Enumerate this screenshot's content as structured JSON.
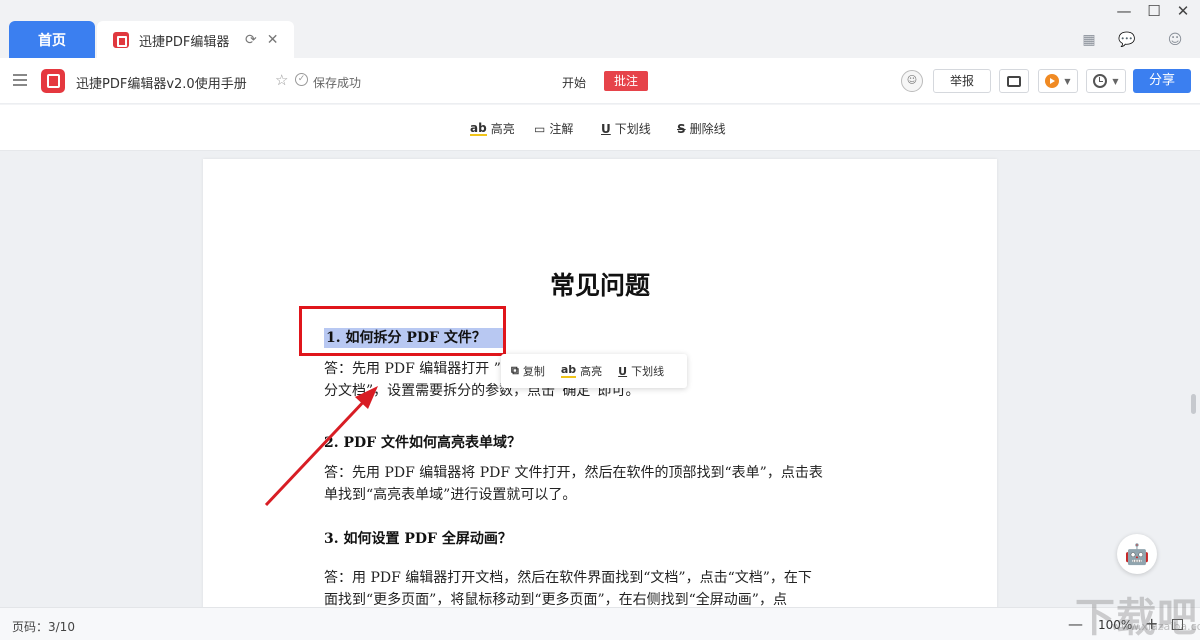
{
  "tabs": {
    "home": "首页",
    "doc": "迅捷PDF编辑器"
  },
  "toolbar": {
    "doc_title": "迅捷PDF编辑器v2.0使用手册",
    "save_status": "保存成功",
    "mode_start": "开始",
    "mode_annotate": "批注",
    "report": "举报",
    "share": "分享"
  },
  "annot_toolbar": {
    "highlight_icon": "ab",
    "highlight": "高亮",
    "note": "注解",
    "underline": "下划线",
    "strikethrough": "删除线"
  },
  "selection_popup": {
    "copy": "复制",
    "highlight_icon": "ab",
    "highlight": "高亮",
    "underline": "下划线"
  },
  "document": {
    "title": "常见问题",
    "q1": "1.  如何拆分 PDF 文件？",
    "a1_line1": "答：先用 PDF 编辑器打开                               ”，点击“文档”，找到“拆",
    "a1_line2": "分文档”，设置需要拆分的参数，点击“确定”即可。",
    "q2": "2.  PDF 文件如何高亮表单域？",
    "a2_line1": "答：先用 PDF 编辑器将 PDF 文件打开，然后在软件的顶部找到“表单”，点击表",
    "a2_line2": "单找到“高亮表单域”进行设置就可以了。",
    "q3": "3.  如何设置 PDF 全屏动画？",
    "a3_line1": "答：用 PDF 编辑器打开文档，然后在软件界面找到“文档”，点击“文档”，在下",
    "a3_line2": "面找到“更多页面”，将鼠标移动到“更多页面”，在右侧找到“全屏动画”，点"
  },
  "status": {
    "page_info": "页码：3/10",
    "zoom": "100%"
  },
  "watermark": {
    "text": "下载吧",
    "sub": "www.xiazaiba.com"
  },
  "colors": {
    "accent": "#3b7ff0",
    "annotate_tag": "#e6434a",
    "highlight_box": "#e0151b",
    "selection": "#b8c8f2"
  }
}
